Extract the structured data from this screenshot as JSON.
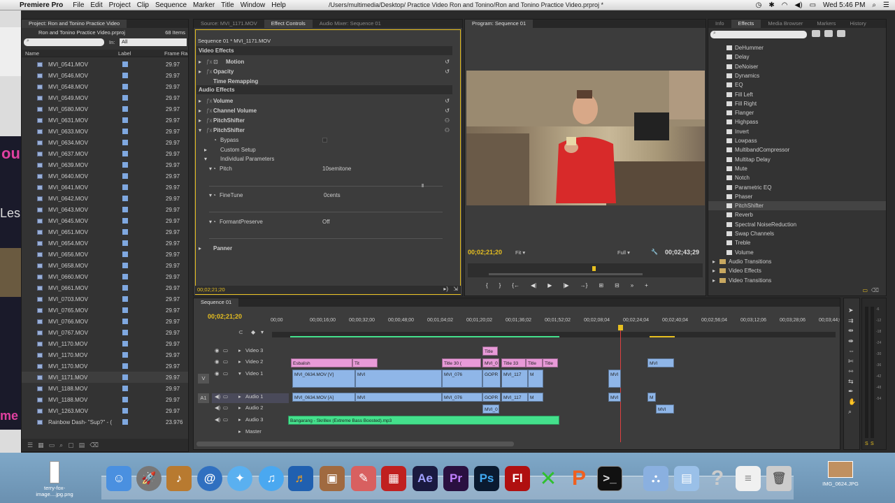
{
  "menubar": {
    "app": "Premiere Pro",
    "items": [
      "File",
      "Edit",
      "Project",
      "Clip",
      "Sequence",
      "Marker",
      "Title",
      "Window",
      "Help"
    ],
    "path": "/Users/multimedia/Desktop/ Practice Video Ron and Tonino/Ron and Tonino Practice Video.prproj *",
    "clock": "Wed 5:46 PM"
  },
  "project": {
    "tab": "Project: Ron and Tonino Practice Video",
    "filename": "Ron and Tonino Practice Video.prproj",
    "count": "68 Items",
    "in_label": "In:",
    "in_value": "All",
    "col_name": "Name",
    "col_label": "Label",
    "col_rate": "Frame Ra",
    "files": [
      {
        "name": "MVI_0541.MOV",
        "rate": "29.97"
      },
      {
        "name": "MVI_0546.MOV",
        "rate": "29.97"
      },
      {
        "name": "MVI_0548.MOV",
        "rate": "29.97"
      },
      {
        "name": "MVI_0549.MOV",
        "rate": "29.97"
      },
      {
        "name": "MVI_0580.MOV",
        "rate": "29.97"
      },
      {
        "name": "MVI_0631.MOV",
        "rate": "29.97"
      },
      {
        "name": "MVI_0633.MOV",
        "rate": "29.97"
      },
      {
        "name": "MVI_0634.MOV",
        "rate": "29.97"
      },
      {
        "name": "MVI_0637.MOV",
        "rate": "29.97"
      },
      {
        "name": "MVI_0639.MOV",
        "rate": "29.97"
      },
      {
        "name": "MVI_0640.MOV",
        "rate": "29.97"
      },
      {
        "name": "MVI_0641.MOV",
        "rate": "29.97"
      },
      {
        "name": "MVI_0642.MOV",
        "rate": "29.97"
      },
      {
        "name": "MVI_0643.MOV",
        "rate": "29.97"
      },
      {
        "name": "MVI_0645.MOV",
        "rate": "29.97"
      },
      {
        "name": "MVI_0651.MOV",
        "rate": "29.97"
      },
      {
        "name": "MVI_0654.MOV",
        "rate": "29.97"
      },
      {
        "name": "MVI_0656.MOV",
        "rate": "29.97"
      },
      {
        "name": "MVI_0658.MOV",
        "rate": "29.97"
      },
      {
        "name": "MVI_0660.MOV",
        "rate": "29.97"
      },
      {
        "name": "MVI_0661.MOV",
        "rate": "29.97"
      },
      {
        "name": "MVI_0703.MOV",
        "rate": "29.97"
      },
      {
        "name": "MVI_0765.MOV",
        "rate": "29.97"
      },
      {
        "name": "MVI_0766.MOV",
        "rate": "29.97"
      },
      {
        "name": "MVI_0767.MOV",
        "rate": "29.97"
      },
      {
        "name": "MVI_1170.MOV",
        "rate": "29.97"
      },
      {
        "name": "MVI_1170.MOV",
        "rate": "29.97"
      },
      {
        "name": "MVI_1170.MOV",
        "rate": "29.97"
      },
      {
        "name": "MVI_1171.MOV",
        "rate": "29.97"
      },
      {
        "name": "MVI_1188.MOV",
        "rate": "29.97"
      },
      {
        "name": "MVI_1188.MOV",
        "rate": "29.97"
      },
      {
        "name": "MVI_1263.MOV",
        "rate": "29.97"
      },
      {
        "name": "Rainbow Dash- \"Sup?\" - (",
        "rate": "23.976"
      }
    ]
  },
  "effect_controls": {
    "tabs": [
      "Source: MVI_1171.MOV",
      "Effect Controls",
      "Audio Mixer: Sequence 01"
    ],
    "sequence": "Sequence 01 * MVI_1171.MOV",
    "video_effects": "Video Effects",
    "motion": "Motion",
    "opacity": "Opacity",
    "time_remap": "Time Remapping",
    "audio_effects": "Audio Effects",
    "volume": "Volume",
    "channel_volume": "Channel Volume",
    "pitch1": "PitchShifter",
    "pitch2": "PitchShifter",
    "bypass": "Bypass",
    "custom_setup": "Custom Setup",
    "indiv": "Individual Parameters",
    "pitch": "Pitch",
    "pitch_val": "10semitone",
    "finetune": "FineTune",
    "finetune_val": "0cents",
    "formant": "FormantPreserve",
    "formant_val": "Off",
    "panner": "Panner",
    "timecode": "00;02;21;20"
  },
  "program": {
    "tab": "Program: Sequence 01",
    "timecode": "00;02;21;20",
    "fit": "Fit",
    "full": "Full",
    "duration": "00;02;43;29"
  },
  "effects_panel": {
    "tabs": [
      "Info",
      "Effects",
      "Media Browser",
      "Markers",
      "History"
    ],
    "items": [
      "DeHummer",
      "Delay",
      "DeNoiser",
      "Dynamics",
      "EQ",
      "Fill Left",
      "Fill Right",
      "Flanger",
      "Highpass",
      "Invert",
      "Lowpass",
      "MultibandCompressor",
      "Multitap Delay",
      "Mute",
      "Notch",
      "Parametric EQ",
      "Phaser",
      "PitchShifter",
      "Reverb",
      "Spectral NoiseReduction",
      "Swap Channels",
      "Treble",
      "Volume"
    ],
    "folders": [
      "Audio Transitions",
      "Video Effects",
      "Video Transitions"
    ]
  },
  "timeline": {
    "tab": "Sequence 01",
    "timecode": "00;02;21;20",
    "ruler": [
      "00;00",
      "00;00;16;00",
      "00;00;32;00",
      "00;00;48;00",
      "00;01;04;02",
      "00;01;20;02",
      "00;01;36;02",
      "00;01;52;02",
      "00;02;08;04",
      "00;02;24;04",
      "00;02;40;04",
      "00;02;56;04",
      "00;03;12;06",
      "00;03;28;06",
      "00;03;44;0"
    ],
    "tracks": [
      "Video 3",
      "Video 2",
      "Video 1",
      "Audio 1",
      "Audio 2",
      "Audio 3",
      "Master"
    ],
    "v_label": "V",
    "a1_label": "A1",
    "clip_title_v3": "Title",
    "clip_esbalish": "Esbalish",
    "clip_tit": "Tit",
    "clip_title30": "Title 30 (",
    "clip_title33": "Title 33",
    "clip_title": "Title",
    "clip_mvi0": "MVI_0",
    "clip_v1": "MVI_0634.MOV [V]",
    "clip_a1": "MVI_0634.MOV [A]",
    "clip_gopr": "GOPR",
    "clip_mvi117": "MVI_117",
    "clip_mvi076": "MVI_076",
    "clip_m": "M",
    "clip_mvi": "MVI",
    "clip_mp3": "Bangarang - Skrillex (Extreme Bass Boosted).mp3"
  },
  "dock": {
    "left_file": "terry-fox-image....jpg.png",
    "right_file": "IMG_0624.JPG",
    "apps": [
      "Ae",
      "Pr",
      "Ps",
      "Fl"
    ]
  },
  "colors": {
    "title_clip": "#e89ad8",
    "video_clip": "#8fb6e8",
    "audio_music": "#44e08c",
    "timecode": "#e8c020"
  }
}
